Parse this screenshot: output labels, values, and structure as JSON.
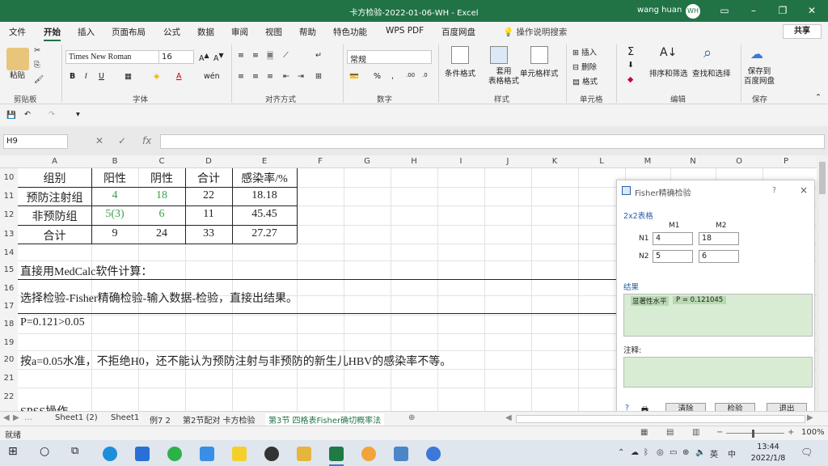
{
  "window": {
    "title": "卡方检验-2022-01-06-WH - Excel",
    "user": "wang huan",
    "avatar": "WH"
  },
  "tabs": [
    "文件",
    "开始",
    "插入",
    "页面布局",
    "公式",
    "数据",
    "审阅",
    "视图",
    "帮助",
    "特色功能",
    "WPS PDF",
    "百度网盘",
    "操作说明搜索"
  ],
  "share_label": "共享",
  "ribbon": {
    "font_name": "Times New Roman",
    "font_size": "16",
    "number_format": "常规",
    "paste_label": "粘贴",
    "cond_format": "条件格式",
    "table_format": "套用\n表格格式",
    "cell_style": "单元格样式",
    "insert": "插入",
    "delete": "删除",
    "format": "格式",
    "sort_filter": "排序和筛选",
    "find_select": "查找和选择",
    "save_baidu": "保存到\n百度网盘",
    "groups": [
      "剪贴板",
      "字体",
      "对齐方式",
      "数字",
      "样式",
      "单元格",
      "编辑",
      "保存"
    ]
  },
  "formula_bar": {
    "name_box": "H9",
    "fx": "fx",
    "formula": ""
  },
  "columns": [
    "A",
    "B",
    "C",
    "D",
    "E",
    "F",
    "G",
    "H",
    "I",
    "J",
    "K",
    "L",
    "M",
    "N",
    "O",
    "P"
  ],
  "rows": [
    "10",
    "11",
    "12",
    "13",
    "14",
    "15",
    "16",
    "17",
    "18",
    "19",
    "20",
    "21",
    "22"
  ],
  "table": {
    "header": [
      "组别",
      "阳性",
      "阴性",
      "合计",
      "感染率/%"
    ],
    "rows": [
      [
        "预防注射组",
        "4",
        "18",
        "22",
        "18.18"
      ],
      [
        "非预防组",
        "5(3)",
        "6",
        "11",
        "45.45"
      ],
      [
        "合计",
        "9",
        "24",
        "33",
        "27.27"
      ]
    ]
  },
  "notes": {
    "line15": "直接用MedCalc软件计算：",
    "line16": "选择检验-Fisher精确检验-输入数据-检验，直接出结果。",
    "line18": "P=0.121>0.05",
    "line20": "按a=0.05水准，不拒绝H0，还不能认为预防注射与非预防的新生儿HBV的感染率不等。",
    "line23": "SPSS操作"
  },
  "dialog": {
    "title": "Fisher精确检验",
    "help": "?",
    "close": "×",
    "section_table": "2x2表格",
    "m1": "M1",
    "m2": "M2",
    "n1": "N1",
    "n2": "N2",
    "n1m1": "4",
    "n1m2": "18",
    "n2m1": "5",
    "n2m2": "6",
    "section_result": "结果",
    "result_label": "显著性水平",
    "result_value": "P = 0.121045",
    "section_note": "注释:",
    "btn_clear": "清除",
    "btn_test": "检验",
    "btn_exit": "退出"
  },
  "sheets": [
    "Sheet1 (2)",
    "Sheet1",
    "例7 2",
    "第2节配对 卡方检验",
    "第3节 四格表Fisher确切概率法"
  ],
  "status": {
    "mode": "就绪",
    "zoom": "100%"
  },
  "taskbar": {
    "time": "13:44",
    "date": "2022/1/8",
    "ime": "英"
  },
  "colors": {
    "excel_green": "#217346",
    "text_green": "#3aa14a",
    "dialog_result_bg": "#d8ecd4"
  }
}
